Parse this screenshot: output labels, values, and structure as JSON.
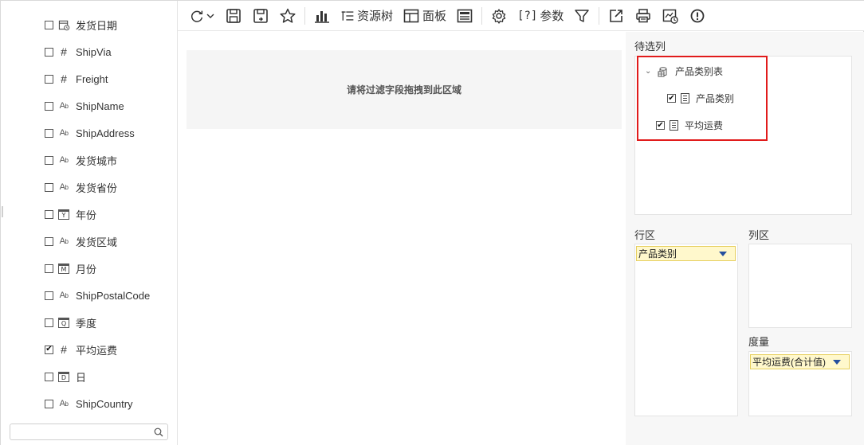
{
  "toolbar": {
    "resource_tree_label": "资源树",
    "panel_label": "面板",
    "params_label": "参数",
    "params_bracket": "[?]"
  },
  "fields": [
    {
      "type": "date",
      "label": "发货日期",
      "checked": false,
      "icon": "calendar-icon"
    },
    {
      "type": "number",
      "label": "ShipVia",
      "checked": false,
      "icon": "hash-icon"
    },
    {
      "type": "number",
      "label": "Freight",
      "checked": false,
      "icon": "hash-icon"
    },
    {
      "type": "string",
      "label": "ShipName",
      "checked": false,
      "icon": "text-type-icon"
    },
    {
      "type": "string",
      "label": "ShipAddress",
      "checked": false,
      "icon": "text-type-icon"
    },
    {
      "type": "string",
      "label": "发货城市",
      "checked": false,
      "icon": "text-type-icon"
    },
    {
      "type": "string",
      "label": "发货省份",
      "checked": false,
      "icon": "text-type-icon"
    },
    {
      "type": "year",
      "label": "年份",
      "checked": false,
      "icon": "year-icon",
      "badge": "Y"
    },
    {
      "type": "string",
      "label": "发货区域",
      "checked": false,
      "icon": "text-type-icon"
    },
    {
      "type": "month",
      "label": "月份",
      "checked": false,
      "icon": "month-icon",
      "badge": "M"
    },
    {
      "type": "string",
      "label": "ShipPostalCode",
      "checked": false,
      "icon": "text-type-icon"
    },
    {
      "type": "quarter",
      "label": "季度",
      "checked": false,
      "icon": "quarter-icon",
      "badge": "Q"
    },
    {
      "type": "number",
      "label": "平均运费",
      "checked": true,
      "icon": "hash-icon"
    },
    {
      "type": "day",
      "label": "日",
      "checked": false,
      "icon": "day-icon",
      "badge": "D"
    },
    {
      "type": "string",
      "label": "ShipCountry",
      "checked": false,
      "icon": "text-type-icon"
    }
  ],
  "search": {
    "value": "",
    "placeholder": ""
  },
  "canvas": {
    "drop_hint": "请将过滤字段拖拽到此区域"
  },
  "right_panel": {
    "candidates_title": "待选列",
    "tree": {
      "table_label": "产品类别表",
      "items": [
        {
          "label": "产品类别",
          "checked": true
        },
        {
          "label": "平均运费",
          "checked": true
        }
      ]
    },
    "rows_title": "行区",
    "columns_title": "列区",
    "measures_title": "度量",
    "row_chip": "产品类别",
    "measure_chip": "平均运费(合计值)"
  },
  "colors": {
    "highlight_border": "#e11b1b",
    "chip_background": "#fff8cc",
    "chip_caret": "#244f9e"
  }
}
